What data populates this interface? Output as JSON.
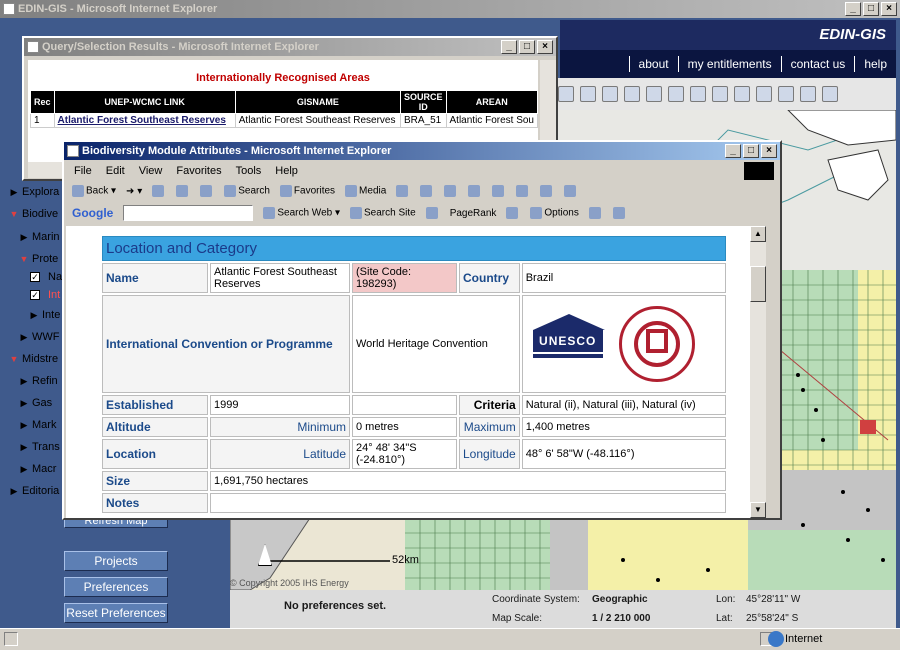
{
  "main_window": {
    "title": "EDIN-GIS - Microsoft Internet Explorer"
  },
  "app": {
    "brand": "EDIN-GIS",
    "nav": [
      "about",
      "my entitlements",
      "contact us",
      "help"
    ]
  },
  "sidebar": {
    "items": [
      {
        "label": "Explora",
        "arrow": "▶",
        "checkbox": false
      },
      {
        "label": "Biodive",
        "arrow": "▼",
        "checkbox": false
      },
      {
        "label": "Marin",
        "arrow": "▶",
        "checkbox": false
      },
      {
        "label": "Prote",
        "arrow": "▼",
        "checkbox": false
      },
      {
        "label": "Na",
        "arrow": "",
        "checkbox": true
      },
      {
        "label": "Int",
        "arrow": "",
        "checkbox": true
      },
      {
        "label": "Inte",
        "arrow": "▶",
        "checkbox": false
      },
      {
        "label": "WWF",
        "arrow": "▶",
        "checkbox": false
      },
      {
        "label": "Midstre",
        "arrow": "▼",
        "checkbox": false
      },
      {
        "label": "Refin",
        "arrow": "▶",
        "checkbox": false
      },
      {
        "label": "Gas",
        "arrow": "▶",
        "checkbox": false
      },
      {
        "label": "Mark",
        "arrow": "▶",
        "checkbox": false
      },
      {
        "label": "Trans",
        "arrow": "▶",
        "checkbox": false
      },
      {
        "label": "Macr",
        "arrow": "▶",
        "checkbox": false
      },
      {
        "label": "Editoria",
        "arrow": "▶",
        "checkbox": false
      }
    ]
  },
  "buttons": {
    "refresh_map": "Refresh Map",
    "projects": "Projects",
    "preferences": "Preferences",
    "reset_preferences": "Reset Preferences"
  },
  "preferences_status": "No preferences set.",
  "map": {
    "scale_label": "52km",
    "copyright": "© Copyright 2005 IHS Energy"
  },
  "info": {
    "coord_system_label": "Coordinate System:",
    "coord_system_value": "Geographic",
    "map_scale_label": "Map Scale:",
    "map_scale_value": "1 / 2 210 000",
    "lon_label": "Lon:",
    "lon_value": "45°28'11\" W",
    "lat_label": "Lat:",
    "lat_value": "25°58'24\" S"
  },
  "status_bar": {
    "zone": "Internet"
  },
  "query_window": {
    "title": "Query/Selection Results - Microsoft Internet Explorer",
    "heading": "Internationally Recognised Areas",
    "columns": [
      "Rec",
      "UNEP-WCMC LINK",
      "GISNAME",
      "SOURCE ID",
      "AREAN"
    ],
    "rows": [
      [
        "1",
        "Atlantic Forest Southeast Reserves",
        "Atlantic Forest Southeast Reserves",
        "BRA_51",
        "Atlantic Forest Sou"
      ]
    ]
  },
  "bio_window": {
    "title": "Biodiversity Module Attributes - Microsoft Internet Explorer",
    "menu": [
      "File",
      "Edit",
      "View",
      "Favorites",
      "Tools",
      "Help"
    ],
    "toolbar": [
      "Back",
      "Search",
      "Favorites",
      "Media"
    ],
    "google": {
      "brand": "Google",
      "search_web": "Search Web",
      "search_site": "Search Site",
      "pagerank": "PageRank",
      "options": "Options"
    },
    "section_heading": "Location and Category",
    "name_label": "Name",
    "name_value": "Atlantic Forest Southeast Reserves",
    "site_code": "(Site Code: 198293)",
    "country_label": "Country",
    "country_value": "Brazil",
    "convention_label": "International Convention or Programme",
    "convention_value": "World Heritage Convention",
    "unesco_logo": "UNESCO",
    "established_label": "Established",
    "established_value": "1999",
    "criteria_label": "Criteria",
    "criteria_value": "Natural (ii), Natural (iii), Natural (iv)",
    "altitude_label": "Altitude",
    "minimum_label": "Minimum",
    "minimum_value": "0 metres",
    "maximum_label": "Maximum",
    "maximum_value": "1,400 metres",
    "location_label": "Location",
    "latitude_label": "Latitude",
    "latitude_value": "24° 48' 34\"S (-24.810°)",
    "longitude_label": "Longitude",
    "longitude_value": "48° 6' 58\"W (-48.116°)",
    "size_label": "Size",
    "size_value": "1,691,750 hectares",
    "notes_label": "Notes"
  },
  "colors": {
    "title_active": "#0a246a",
    "nav_bg": "#0b1540",
    "sidebar_bg": "#3f5a8c",
    "heading_bar": "#3aa3e0",
    "site_code_bg": "#f3c8c8",
    "map_yellow": "#f4f0a8",
    "map_green": "#b8dcb8"
  }
}
